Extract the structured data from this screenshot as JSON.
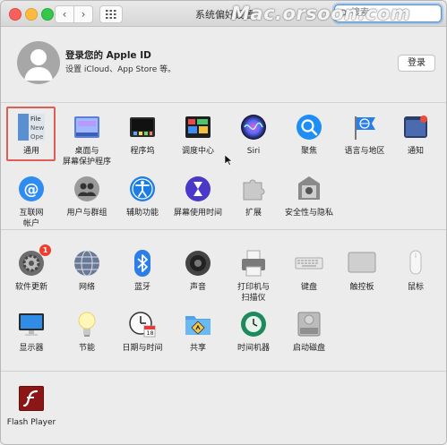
{
  "window": {
    "title": "系统偏好设置",
    "search_placeholder": "搜索",
    "watermark": "Mac.orsoon.com"
  },
  "apple_id": {
    "title": "登录您的 Apple ID",
    "subtitle": "设置 iCloud、App Store 等。",
    "login_button": "登录"
  },
  "section1": [
    {
      "id": "general",
      "label": "通用",
      "icon": "general-icon",
      "selected": true
    },
    {
      "id": "desktop",
      "label": "桌面与\n屏幕保护程序",
      "icon": "desktop-screensaver-icon"
    },
    {
      "id": "dock",
      "label": "程序坞",
      "icon": "dock-icon"
    },
    {
      "id": "mission",
      "label": "调度中心",
      "icon": "mission-control-icon"
    },
    {
      "id": "siri",
      "label": "Siri",
      "icon": "siri-icon"
    },
    {
      "id": "spotlight",
      "label": "聚焦",
      "icon": "spotlight-icon"
    },
    {
      "id": "language",
      "label": "语言与地区",
      "icon": "language-region-icon"
    },
    {
      "id": "notifications",
      "label": "通知",
      "icon": "notifications-icon"
    },
    {
      "id": "internet",
      "label": "互联网\n帐户",
      "icon": "internet-accounts-icon"
    },
    {
      "id": "users",
      "label": "用户与群组",
      "icon": "users-groups-icon"
    },
    {
      "id": "accessibility",
      "label": "辅助功能",
      "icon": "accessibility-icon"
    },
    {
      "id": "screentime",
      "label": "屏幕使用时间",
      "icon": "screen-time-icon"
    },
    {
      "id": "extensions",
      "label": "扩展",
      "icon": "extensions-icon"
    },
    {
      "id": "security",
      "label": "安全性与隐私",
      "icon": "security-privacy-icon"
    }
  ],
  "section2": [
    {
      "id": "softwareupdate",
      "label": "软件更新",
      "icon": "software-update-icon",
      "badge": "1"
    },
    {
      "id": "network",
      "label": "网络",
      "icon": "network-icon"
    },
    {
      "id": "bluetooth",
      "label": "蓝牙",
      "icon": "bluetooth-icon"
    },
    {
      "id": "sound",
      "label": "声音",
      "icon": "sound-icon"
    },
    {
      "id": "printers",
      "label": "打印机与\n扫描仪",
      "icon": "printer-icon"
    },
    {
      "id": "keyboard",
      "label": "键盘",
      "icon": "keyboard-icon"
    },
    {
      "id": "trackpad",
      "label": "触控板",
      "icon": "trackpad-icon"
    },
    {
      "id": "mouse",
      "label": "鼠标",
      "icon": "mouse-icon"
    },
    {
      "id": "displays",
      "label": "显示器",
      "icon": "display-icon"
    },
    {
      "id": "energy",
      "label": "节能",
      "icon": "energy-saver-icon"
    },
    {
      "id": "datetime",
      "label": "日期与时间",
      "icon": "date-time-icon",
      "date_text": "18"
    },
    {
      "id": "sharing",
      "label": "共享",
      "icon": "sharing-icon"
    },
    {
      "id": "timemachine",
      "label": "时间机器",
      "icon": "time-machine-icon"
    },
    {
      "id": "startupdisk",
      "label": "启动磁盘",
      "icon": "startup-disk-icon"
    }
  ],
  "section3": [
    {
      "id": "flash",
      "label": "Flash Player",
      "icon": "flash-player-icon"
    }
  ],
  "general_icon_text": [
    "File",
    "New",
    "Ope"
  ]
}
